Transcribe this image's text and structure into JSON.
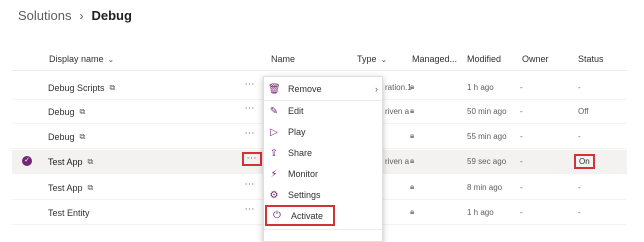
{
  "breadcrumb": {
    "root": "Solutions",
    "separator": "›",
    "current": "Debug"
  },
  "columns": {
    "display_name": "Display name",
    "name": "Name",
    "type": "Type",
    "managed": "Managed...",
    "modified": "Modified",
    "owner": "Owner",
    "status": "Status"
  },
  "rows": [
    {
      "display_name": "Debug Scripts",
      "partial": "ration.1",
      "modified": "1 h ago",
      "owner": "-",
      "status": "-"
    },
    {
      "display_name": "Debug",
      "partial": "riven a",
      "modified": "50 min ago",
      "owner": "-",
      "status": "Off"
    },
    {
      "display_name": "Debug",
      "partial": "",
      "modified": "55 min ago",
      "owner": "-",
      "status": "-"
    },
    {
      "display_name": "Test App",
      "partial": "riven a",
      "modified": "59 sec ago",
      "owner": "-",
      "status": "On"
    },
    {
      "display_name": "Test App",
      "partial": "",
      "modified": "8 min ago",
      "owner": "-",
      "status": "-"
    },
    {
      "display_name": "Test Entity",
      "partial": "",
      "modified": "1 h ago",
      "owner": "-",
      "status": "-"
    }
  ],
  "menu": {
    "items": [
      "Remove",
      "Edit",
      "Play",
      "Share",
      "Monitor",
      "Settings",
      "Activate"
    ]
  },
  "colors": {
    "accent": "#742774",
    "highlight": "#d13438"
  },
  "icons": {
    "remove": "trash-icon",
    "edit": "pencil-icon",
    "play": "play-icon",
    "share": "share-icon",
    "monitor": "monitor-icon",
    "settings": "gear-icon",
    "activate": "power-icon"
  }
}
